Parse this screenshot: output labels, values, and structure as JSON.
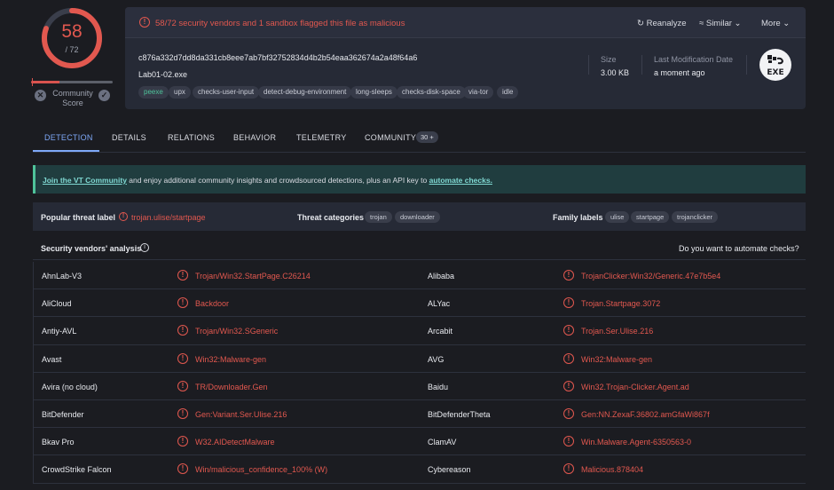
{
  "score": {
    "detections": "58",
    "total": "/ 72",
    "detection_fraction": 0.806,
    "community_label": "Community\nScore",
    "colors": {
      "malicious": "#e2584f",
      "ring_track": "#3a3e4b"
    }
  },
  "header": {
    "warning": "58/72 security vendors and 1 sandbox flagged this file as malicious",
    "actions": {
      "reanalyze": "Reanalyze",
      "similar": "Similar",
      "more": "More"
    },
    "hash": "c876a332d7dd8da331cb8eee7ab7bf32752834d4b2b54eaa362674a2a48f64a6",
    "filename": "Lab01-02.exe",
    "tags": [
      "peexe",
      "upx",
      "checks-user-input",
      "detect-debug-environment",
      "long-sleeps",
      "checks-disk-space",
      "via-tor",
      "idle"
    ],
    "size_label": "Size",
    "size_value": "3.00 KB",
    "modified_label": "Last Modification Date",
    "modified_value": "a moment ago",
    "file_type_badge": "EXE"
  },
  "tabs": {
    "detection": "DETECTION",
    "details": "DETAILS",
    "relations": "RELATIONS",
    "behavior": "BEHAVIOR",
    "telemetry": "TELEMETRY",
    "community": "COMMUNITY",
    "community_count": "30 +"
  },
  "banner": {
    "link1": "Join the VT Community",
    "text": " and enjoy additional community insights and crowdsourced detections, plus an API key to ",
    "link2": "automate checks."
  },
  "threat": {
    "popular_label": "Popular threat label",
    "popular_value": "trojan.ulise/startpage",
    "categories_label": "Threat categories",
    "categories": [
      "trojan",
      "downloader"
    ],
    "family_label": "Family labels",
    "families": [
      "ulise",
      "startpage",
      "trojanclicker"
    ]
  },
  "vendors": {
    "title": "Security vendors' analysis",
    "automate": "Do you want to automate checks?",
    "rows": [
      {
        "v1": "AhnLab-V3",
        "r1": "Trojan/Win32.StartPage.C26214",
        "v2": "Alibaba",
        "r2": "TrojanClicker:Win32/Generic.47e7b5e4"
      },
      {
        "v1": "AliCloud",
        "r1": "Backdoor",
        "v2": "ALYac",
        "r2": "Trojan.Startpage.3072"
      },
      {
        "v1": "Antiy-AVL",
        "r1": "Trojan/Win32.SGeneric",
        "v2": "Arcabit",
        "r2": "Trojan.Ser.Ulise.216"
      },
      {
        "v1": "Avast",
        "r1": "Win32:Malware-gen",
        "v2": "AVG",
        "r2": "Win32:Malware-gen"
      },
      {
        "v1": "Avira (no cloud)",
        "r1": "TR/Downloader.Gen",
        "v2": "Baidu",
        "r2": "Win32.Trojan-Clicker.Agent.ad"
      },
      {
        "v1": "BitDefender",
        "r1": "Gen:Variant.Ser.Ulise.216",
        "v2": "BitDefenderTheta",
        "r2": "Gen:NN.ZexaF.36802.amGfaWi867f"
      },
      {
        "v1": "Bkav Pro",
        "r1": "W32.AIDetectMalware",
        "v2": "ClamAV",
        "r2": "Win.Malware.Agent-6350563-0"
      },
      {
        "v1": "CrowdStrike Falcon",
        "r1": "Win/malicious_confidence_100% (W)",
        "v2": "Cybereason",
        "r2": "Malicious.878404"
      }
    ]
  }
}
